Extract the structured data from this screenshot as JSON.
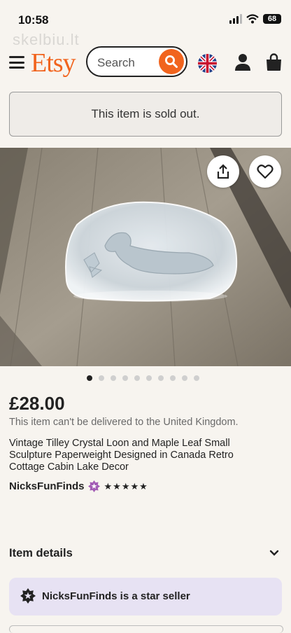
{
  "status_bar": {
    "time": "10:58",
    "battery": "68"
  },
  "watermark": "skelbiu.lt",
  "header": {
    "logo": "Etsy",
    "search_placeholder": "Search",
    "icons": [
      "menu-icon",
      "search-icon",
      "uk-flag-icon",
      "account-icon",
      "shopping-bag-icon"
    ]
  },
  "sold_out_message": "This item is sold out.",
  "gallery": {
    "total_images": 10,
    "current_image": 1,
    "icons": [
      "share-icon",
      "heart-icon"
    ]
  },
  "listing": {
    "price": "£28.00",
    "delivery_note": "This item can't be delivered to the United Kingdom.",
    "title": "Vintage Tilley Crystal Loon and Maple Leaf Small Sculpture Paperweight Designed in Canada Retro Cottage Cabin Lake Decor",
    "shop_name": "NicksFunFinds",
    "rating_stars": 5
  },
  "item_details_label": "Item details",
  "star_seller_text": "NicksFunFinds is a star seller",
  "colors": {
    "accent": "#f1641e",
    "star_seller_bg": "#e7e2f3",
    "badge_purple": "#a35db5"
  }
}
